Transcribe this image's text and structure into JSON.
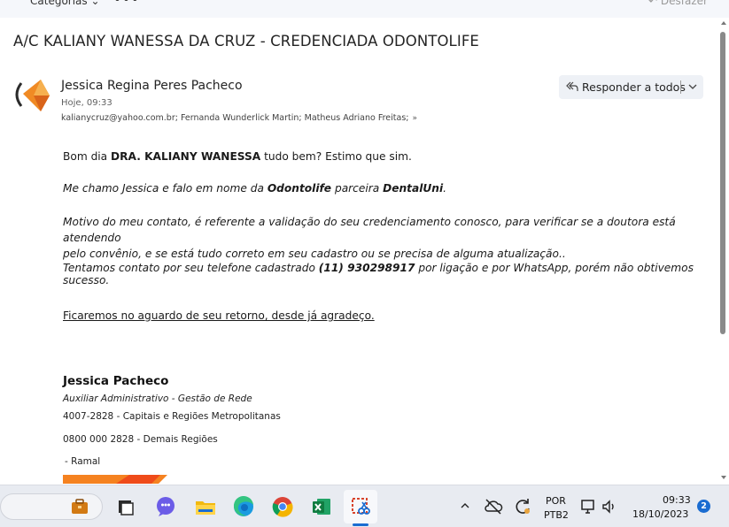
{
  "toolbar": {
    "categories_label": "Categorias",
    "more_label": "•••",
    "undo_label": "Desfazer"
  },
  "email": {
    "subject": "A/C KALIANY WANESSA DA CRUZ - CREDENCIADA ODONTOLIFE",
    "sender_name": "Jessica Regina Peres Pacheco",
    "date": "Hoje, 09:33",
    "recipients": "kalianycruz@yahoo.com.br; Fernanda Wunderlick Martin; Matheus Adriano Freitas;",
    "reply_all_label": "Responder a todos"
  },
  "body": {
    "p1_a": "Bom dia ",
    "p1_b": "DRA. KALIANY WANESSA",
    "p1_c": " tudo bem? Estimo que sim.",
    "p2_a": "Me chamo Jessica e falo em nome da ",
    "p2_b": "Odontolife",
    "p2_c": " parceira ",
    "p2_d": "DentalUni",
    "p2_e": ".",
    "p3_line1": "Motivo do meu contato, é referente a validação do seu credenciamento conosco, para verificar se a doutora está atendendo",
    "p3_line2": "pelo convênio, e se está tudo correto em seu cadastro ou se precisa de alguma atualização..",
    "p4_a": "Tentamos contato por seu telefone cadastrado  ",
    "p4_b": "(11) 930298917",
    "p4_c": " por ligação e por WhatsApp, porém não obtivemos sucesso.",
    "p5": "Ficaremos no aguardo de seu retorno, desde já agradeço."
  },
  "signature": {
    "name": "Jessica Pacheco",
    "role": "Auxiliar Administrativo - Gestão de Rede",
    "line1": "4007-2828 - Capitais e Regiões Metropolitanas",
    "line2": "0800 000 2828 - Demais Regiões",
    "line3": " - Ramal"
  },
  "taskbar": {
    "lang_top": "POR",
    "lang_bottom": "PTB2",
    "time": "09:33",
    "date": "18/10/2023",
    "notification_count": "2"
  },
  "colors": {
    "accent": "#1a6cd1",
    "brand_orange": "#f0641e"
  }
}
